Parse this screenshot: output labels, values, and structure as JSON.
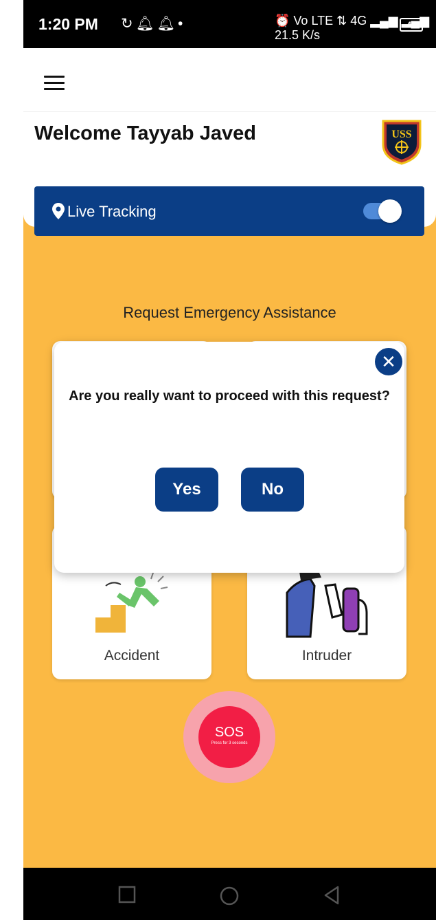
{
  "status_bar": {
    "time": "1:20 PM",
    "left_icons": [
      "sync-icon",
      "bell-icon",
      "bell-icon",
      "dot-icon"
    ],
    "right_icons": "⏰ Vo LTE ⇅ 4G ▂▄▆ ▂▄▆ 21.5 K/s",
    "battery": "43"
  },
  "header": {
    "menu_icon": "hamburger-menu-icon",
    "welcome_text": "Welcome Tayyab Javed",
    "logo_text": "USS"
  },
  "tracking": {
    "label": "Live Tracking",
    "icon": "location-pin-icon",
    "enabled": true
  },
  "main": {
    "section_title": "Request Emergency Assistance",
    "cards": [
      {
        "label": "Accident",
        "icon": "accident-fall-icon"
      },
      {
        "label": "Intruder",
        "icon": "intruder-icon"
      }
    ],
    "sos": {
      "label": "SOS",
      "sublabel": "Press for 3 seconds"
    }
  },
  "dialog": {
    "message": "Are you really want to proceed with this request?",
    "yes_label": "Yes",
    "no_label": "No",
    "close_icon": "close-icon"
  },
  "nav_bar": {
    "buttons": [
      "recents-square-icon",
      "home-circle-icon",
      "back-triangle-icon"
    ]
  },
  "colors": {
    "accent": "#0b3e86",
    "background": "#fbb944",
    "sos_red": "#f21e45"
  }
}
